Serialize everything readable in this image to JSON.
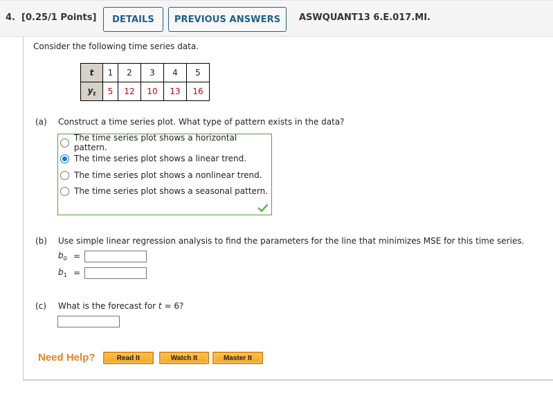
{
  "header": {
    "question_number": "4.",
    "points": "[0.25/1 Points]",
    "details_label": "DETAILS",
    "previous_answers_label": "PREVIOUS ANSWERS",
    "assignment_code": "ASWQUANT13 6.E.017.MI."
  },
  "intro": "Consider the following time series data.",
  "table": {
    "row1_header": "t",
    "row2_header": "y",
    "row2_header_sub": "t",
    "t": [
      "1",
      "2",
      "3",
      "4",
      "5"
    ],
    "y": [
      "5",
      "12",
      "10",
      "13",
      "16"
    ],
    "value_color": "#cc0000"
  },
  "part_a": {
    "label": "(a)",
    "question": "Construct a time series plot. What type of pattern exists in the data?",
    "options": [
      {
        "label": "The time series plot shows a horizontal pattern.",
        "selected": false
      },
      {
        "label": "The time series plot shows a linear trend.",
        "selected": true
      },
      {
        "label": "The time series plot shows a nonlinear trend.",
        "selected": false
      },
      {
        "label": "The time series plot shows a seasonal pattern.",
        "selected": false
      }
    ],
    "status_icon": "check-icon",
    "status": "correct"
  },
  "part_b": {
    "label": "(b)",
    "question": "Use simple linear regression analysis to find the parameters for the line that minimizes MSE for this time series.",
    "b0": {
      "var": "b",
      "sub": "0",
      "eq": "=",
      "value": ""
    },
    "b1": {
      "var": "b",
      "sub": "1",
      "eq": "=",
      "value": ""
    }
  },
  "part_c": {
    "label": "(c)",
    "question_pre": "What is the forecast for ",
    "question_var": "t",
    "question_post": " = 6?",
    "value": ""
  },
  "help": {
    "label": "Need Help?",
    "buttons": [
      "Read It",
      "Watch It",
      "Master It"
    ]
  }
}
